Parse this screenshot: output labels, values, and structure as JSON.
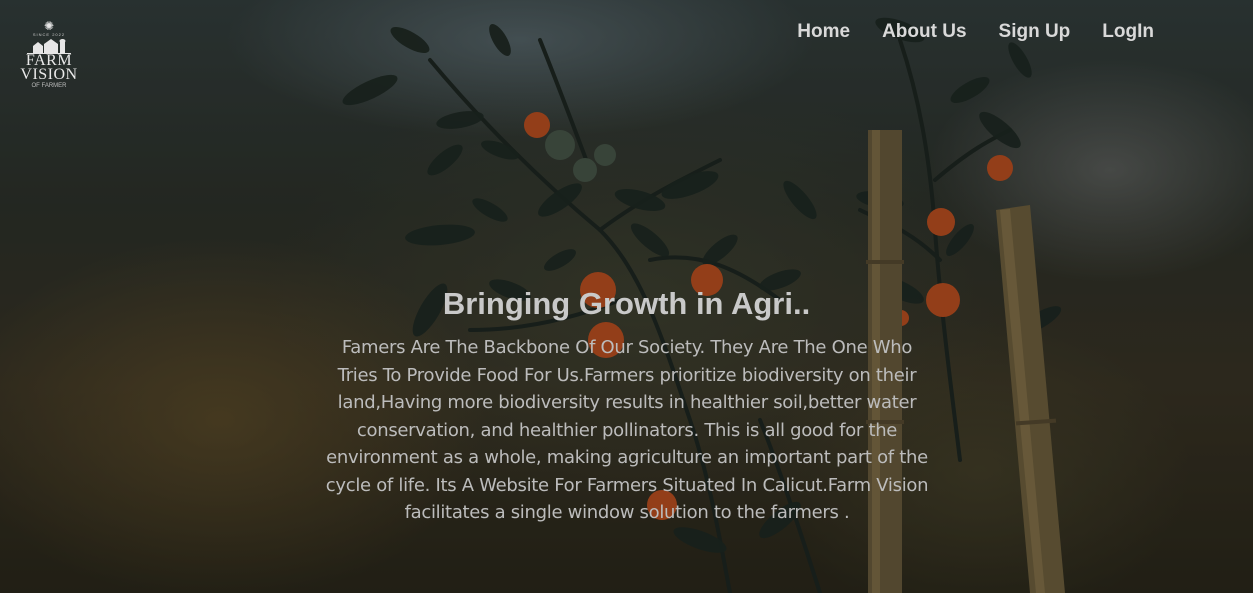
{
  "logo": {
    "tiny_text": "SINCE 2022",
    "word1": "FARM",
    "word2": "VISION",
    "tagline": "OF FARMER"
  },
  "nav": {
    "items": [
      "Home",
      "About Us",
      "Sign Up",
      "LogIn"
    ]
  },
  "hero": {
    "title": "Bringing Growth in Agri..",
    "description": "Famers Are The Backbone Of Our Society. They Are The One Who Tries To Provide Food For Us.Farmers prioritize biodiversity on their land,Having more biodiversity results in healthier soil,better water conservation, and healthier pollinators. This is all good for the environment as a whole, making agriculture an important part of the cycle of life. Its A Website For Farmers Situated In Calicut.Farm Vision facilitates a single window solution to the farmers ."
  },
  "colors": {
    "text_light": "#d9d9d9",
    "tomato": "#c8521f",
    "leaf": "#1f2a22"
  }
}
